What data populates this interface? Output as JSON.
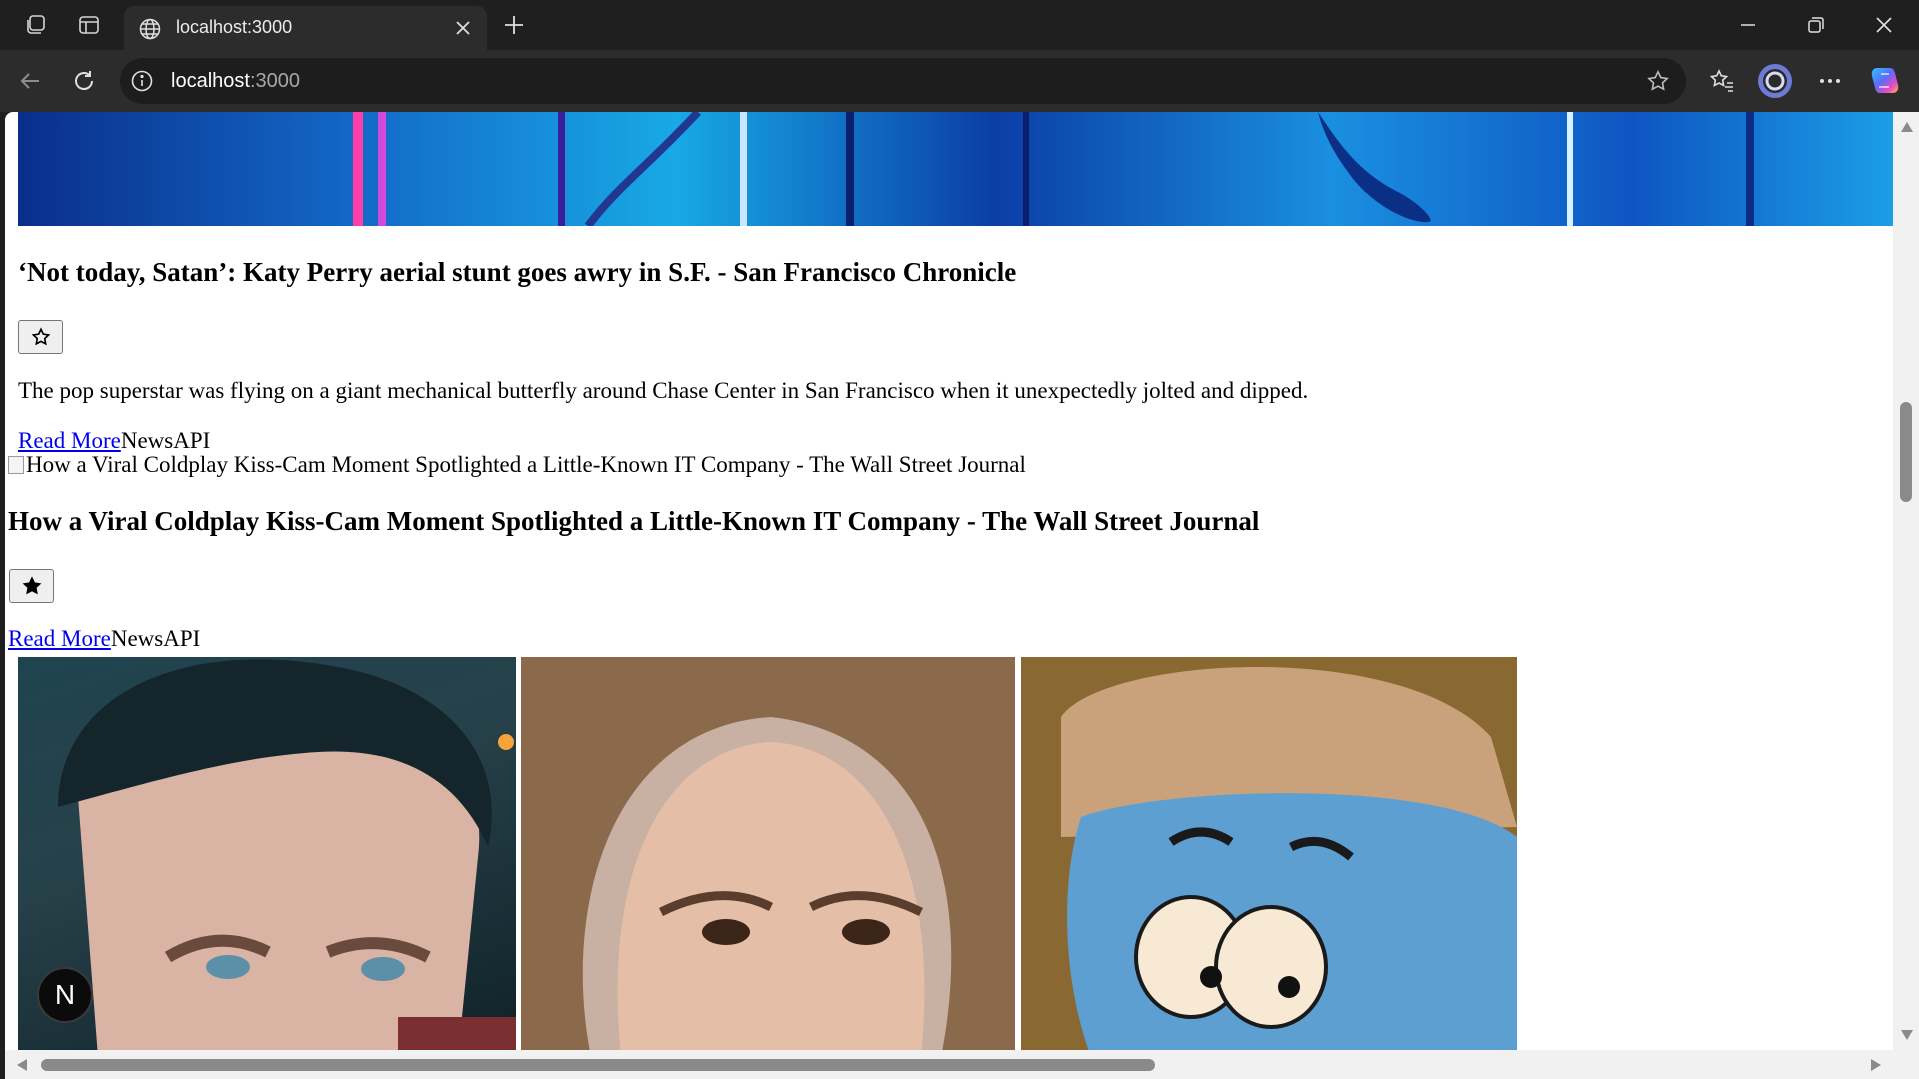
{
  "browser": {
    "tab_title": "localhost:3000",
    "address_host": "localhost",
    "address_port": ":3000"
  },
  "articles": [
    {
      "title": "‘Not today, Satan’: Katy Perry aerial stunt goes awry in S.F. - San Francisco Chronicle",
      "favorited": false,
      "description": "The pop superstar was flying on a giant mechanical butterfly around Chase Center in San Francisco when it unexpectedly jolted and dipped.",
      "read_more": "Read More",
      "source": "NewsAPI"
    },
    {
      "image_alt": "How a Viral Coldplay Kiss-Cam Moment Spotlighted a Little-Known IT Company - The Wall Street Journal",
      "title": "How a Viral Coldplay Kiss-Cam Moment Spotlighted a Little-Known IT Company - The Wall Street Journal",
      "favorited": true,
      "read_more": "Read More",
      "source": "NewsAPI"
    }
  ],
  "floating_button": {
    "label": "N"
  }
}
